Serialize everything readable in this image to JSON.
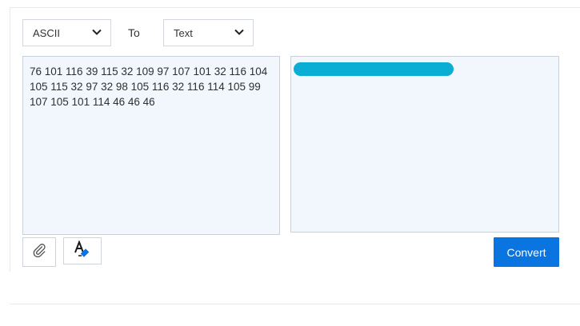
{
  "converter": {
    "from_select": {
      "value": "ASCII"
    },
    "to_label": "To",
    "to_select": {
      "value": "Text"
    },
    "input": {
      "value": "76 101 116 39 115 32 109 97 107 101 32 116 104 105 115 32 97 32 98 105 116 32 116 114 105 99 107 105 101 114 46 46 46"
    },
    "output": {
      "value_redacted": true
    },
    "convert_label": "Convert"
  },
  "icons": [
    "chevron-down-icon",
    "paperclip-icon",
    "text-clear-icon"
  ],
  "colors": {
    "accent": "#0a74e0",
    "textarea_bg": "#f2f7fd",
    "redaction": "#0aadd3"
  }
}
